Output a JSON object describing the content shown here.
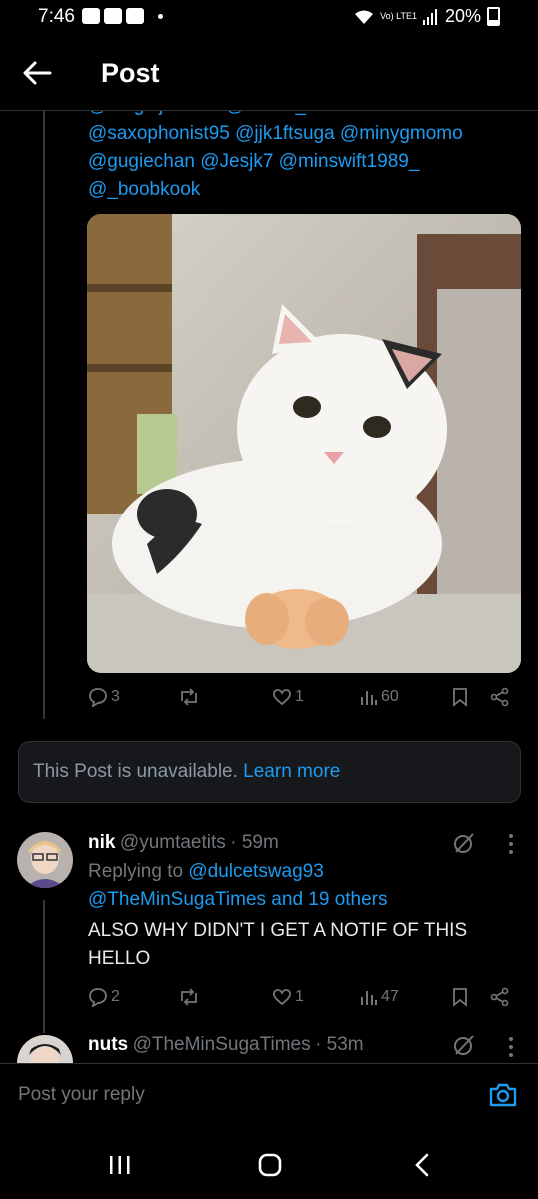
{
  "status_bar": {
    "time": "7:46",
    "network": "Vo) LTE1",
    "battery": "20%"
  },
  "header": {
    "title": "Post"
  },
  "post": {
    "mentions_lines": [
      "@hotgirljkooker @vintae_soul",
      "@saxophonist95 @jjk1ftsuga @minygmomo",
      "@gugiechan @Jesjk7 @minswift1989_",
      "@_boobkook"
    ],
    "image_alt": "white and black cat with tiny plastic hands",
    "actions": {
      "replies": "3",
      "reposts": "",
      "likes": "1",
      "views": "60"
    }
  },
  "unavailable": {
    "text": "This Post is unavailable.",
    "link": "Learn more"
  },
  "reply1": {
    "name": "nik",
    "handle": "@yumtaetits",
    "time": "· 59m",
    "replying_prefix": "Replying to",
    "replying_to": "@dulcetswag93",
    "replying_more": "@TheMinSugaTimes and 19 others",
    "text_line1": "ALSO WHY DIDN'T I GET A NOTIF OF THIS",
    "text_line2": "HELLO",
    "actions": {
      "replies": "2",
      "likes": "1",
      "views": "47"
    }
  },
  "reply2": {
    "name": "nuts",
    "handle": "@TheMinSugaTimes",
    "time": "· 53m"
  },
  "reply_box": {
    "placeholder": "Post your reply"
  },
  "colors": {
    "accent": "#1d9bf0",
    "muted": "#71767b",
    "background": "#000000"
  }
}
